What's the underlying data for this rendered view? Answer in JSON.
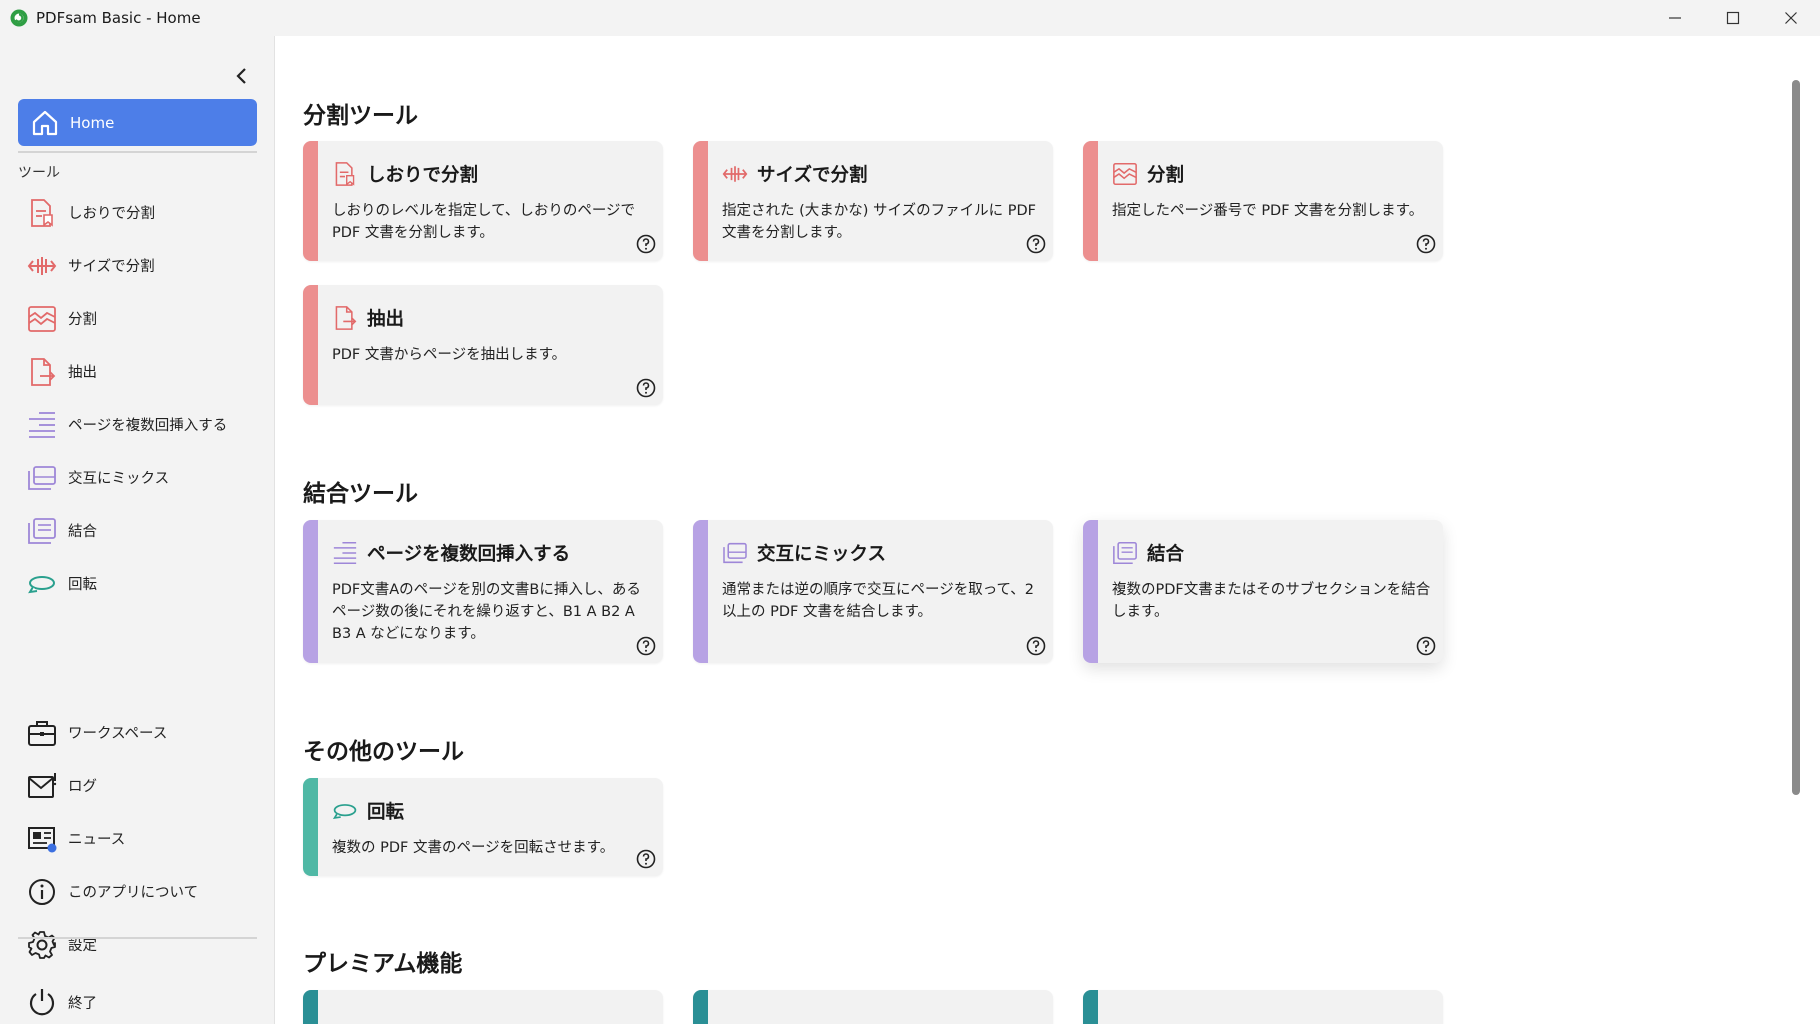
{
  "window": {
    "title": "PDFsam Basic - Home",
    "controls": {
      "minimize": "minimize-icon",
      "maximize": "maximize-icon",
      "close": "close-icon"
    }
  },
  "sidebar": {
    "home_label": "Home",
    "tools_header": "ツール",
    "items": [
      {
        "label": "しおりで分割",
        "icon": "split-by-bookmarks-icon",
        "color": "#e26a6a"
      },
      {
        "label": "サイズで分割",
        "icon": "split-by-size-icon",
        "color": "#e26a6a"
      },
      {
        "label": "分割",
        "icon": "split-icon",
        "color": "#e26a6a"
      },
      {
        "label": "抽出",
        "icon": "extract-icon",
        "color": "#e26a6a"
      },
      {
        "label": "ページを複数回挿入する",
        "icon": "insert-pages-icon",
        "color": "#9e87d8"
      },
      {
        "label": "交互にミックス",
        "icon": "alternate-mix-icon",
        "color": "#9e87d8"
      },
      {
        "label": "結合",
        "icon": "merge-icon",
        "color": "#9e87d8"
      },
      {
        "label": "回転",
        "icon": "rotate-icon",
        "color": "#2aa08e"
      }
    ],
    "bottom_items": [
      {
        "label": "ワークスペース",
        "icon": "briefcase-icon"
      },
      {
        "label": "ログ",
        "icon": "mail-alert-icon"
      },
      {
        "label": "ニュース",
        "icon": "news-icon"
      },
      {
        "label": "このアプリについて",
        "icon": "info-icon"
      },
      {
        "label": "設定",
        "icon": "gear-icon"
      }
    ],
    "quit_label": "終了"
  },
  "main": {
    "sections": [
      {
        "title": "分割ツール",
        "cards": [
          {
            "title": "しおりで分割",
            "desc": "しおりのレベルを指定して、しおりのページで PDF 文書を分割します。",
            "icon": "split-by-bookmarks-icon"
          },
          {
            "title": "サイズで分割",
            "desc": "指定された (大まかな) サイズのファイルに PDF 文書を分割します。",
            "icon": "split-by-size-icon"
          },
          {
            "title": "分割",
            "desc": "指定したページ番号で PDF 文書を分割します。",
            "icon": "split-icon"
          },
          {
            "title": "抽出",
            "desc": "PDF 文書からページを抽出します。",
            "icon": "extract-icon"
          }
        ]
      },
      {
        "title": "結合ツール",
        "cards": [
          {
            "title": "ページを複数回挿入する",
            "desc": "PDF文書Aのページを別の文書Bに挿入し、あるページ数の後にそれを繰り返すと、B1 A B2 A B3 A などになります。",
            "icon": "insert-pages-icon"
          },
          {
            "title": "交互にミックス",
            "desc": "通常または逆の順序で交互にページを取って、2 以上の PDF 文書を結合します。",
            "icon": "alternate-mix-icon"
          },
          {
            "title": "結合",
            "desc": "複数のPDF文書またはそのサブセクションを結合します。",
            "icon": "merge-icon"
          }
        ]
      },
      {
        "title": "その他のツール",
        "cards": [
          {
            "title": "回転",
            "desc": "複数の PDF 文書のページを回転させます。",
            "icon": "rotate-icon"
          }
        ]
      },
      {
        "title": "プレミアム機能",
        "cards": []
      }
    ],
    "help_icon": "help-icon"
  },
  "colors": {
    "accent": "#4d7ee8",
    "split_stripe": "#ec8f8f",
    "merge_stripe": "#b7a2e4",
    "other_stripe": "#4fb8a5",
    "premium_stripe": "#2a8f95"
  }
}
